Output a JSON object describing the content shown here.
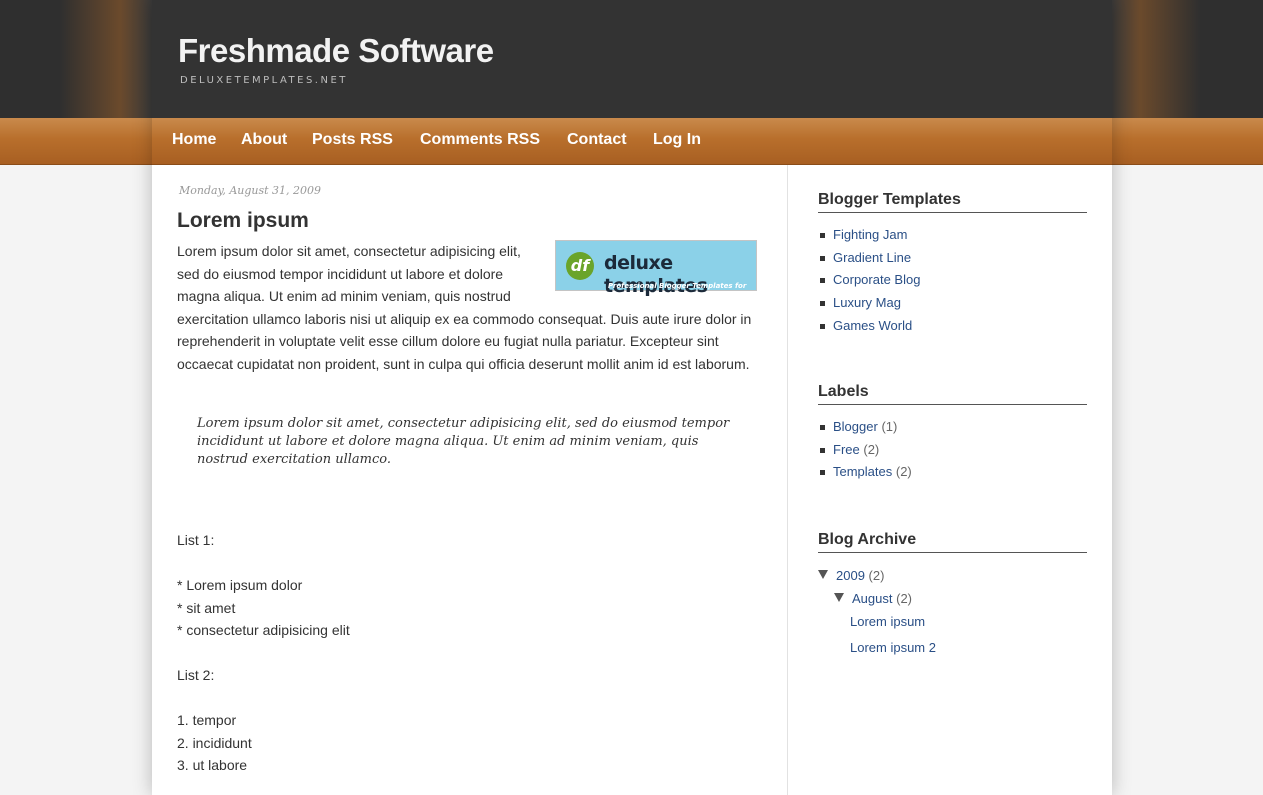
{
  "header": {
    "title": "Freshmade Software",
    "description": "DELUXETEMPLATES.NET"
  },
  "nav": {
    "items": [
      {
        "label": "Home"
      },
      {
        "label": "About"
      },
      {
        "label": "Posts RSS"
      },
      {
        "label": "Comments RSS"
      },
      {
        "label": "Contact"
      },
      {
        "label": "Log In"
      }
    ]
  },
  "post": {
    "date": "Monday, August 31, 2009",
    "title": "Lorem ipsum",
    "image": {
      "icon_text": "df",
      "logo_text": "deluxe templates",
      "logo_sub": "Professional Blogger Templates for Free"
    },
    "paragraph": "Lorem ipsum dolor sit amet, consectetur adipisicing elit, sed do eiusmod tempor incididunt ut labore et dolore magna aliqua. Ut enim ad minim veniam, quis nostrud exercitation ullamco laboris nisi ut aliquip ex ea commodo consequat. Duis aute irure dolor in reprehenderit in voluptate velit esse cillum dolore eu fugiat nulla pariatur. Excepteur sint occaecat cupidatat non proident, sunt in culpa qui officia deserunt mollit anim id est laborum.",
    "blockquote": "Lorem ipsum dolor sit amet, consectetur adipisicing elit, sed do eiusmod tempor incididunt ut labore et dolore magna aliqua. Ut enim ad minim veniam, quis nostrud exercitation ullamco.",
    "list1_title": "List 1:",
    "list1": [
      "* Lorem ipsum dolor",
      "* sit amet",
      "* consectetur adipisicing elit"
    ],
    "list2_title": "List 2:",
    "list2": [
      "1. tempor",
      "2. incididunt",
      "3. ut labore"
    ]
  },
  "sidebar": {
    "templates": {
      "title": "Blogger Templates",
      "items": [
        {
          "label": "Fighting Jam"
        },
        {
          "label": "Gradient Line"
        },
        {
          "label": "Corporate Blog"
        },
        {
          "label": "Luxury Mag"
        },
        {
          "label": "Games World"
        }
      ]
    },
    "labels": {
      "title": "Labels",
      "items": [
        {
          "label": "Blogger",
          "count": "(1)"
        },
        {
          "label": "Free",
          "count": "(2)"
        },
        {
          "label": "Templates",
          "count": "(2)"
        }
      ]
    },
    "archive": {
      "title": "Blog Archive",
      "year": {
        "label": "2009",
        "count": "(2)"
      },
      "month": {
        "label": "August",
        "count": "(2)"
      },
      "posts": [
        {
          "label": "Lorem ipsum"
        },
        {
          "label": "Lorem ipsum 2"
        }
      ]
    }
  },
  "colors": {
    "header_bg": "#333333",
    "nav_orange": "#b86f2c",
    "link": "#2a4f86"
  }
}
